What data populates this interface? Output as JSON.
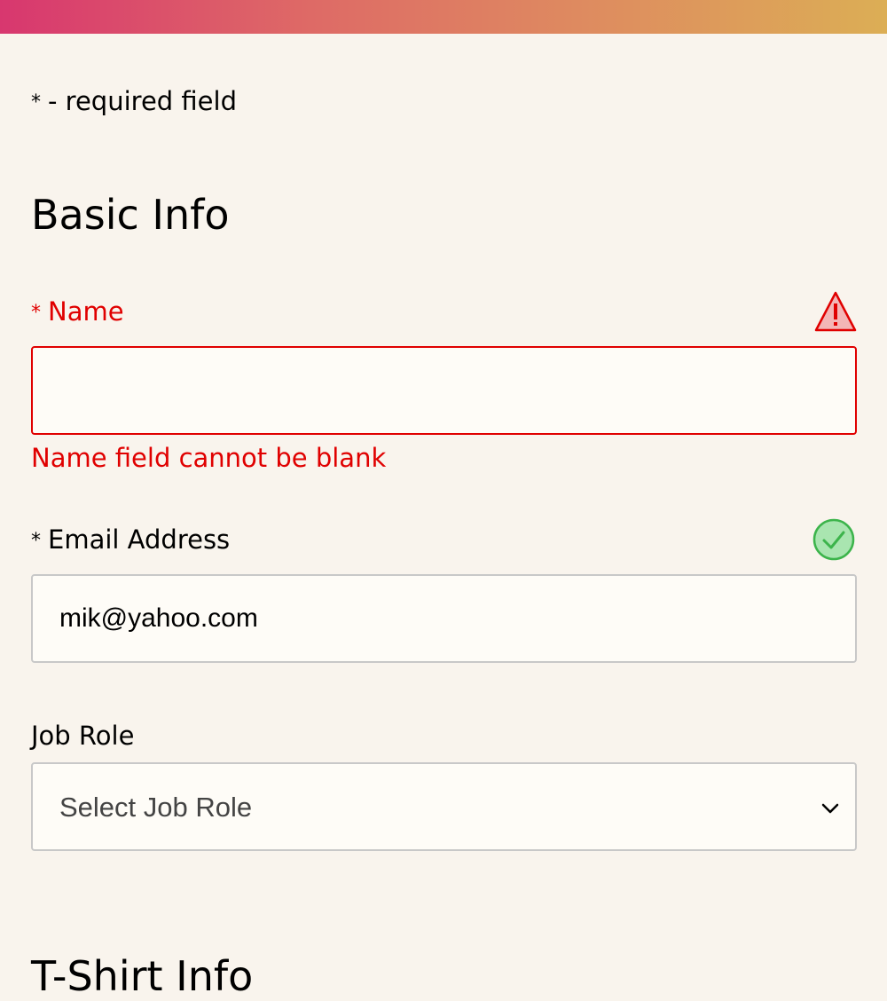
{
  "required_note": {
    "symbol": "*",
    "text": "- required field"
  },
  "basic_info": {
    "title": "Basic Info",
    "name_field": {
      "symbol": "*",
      "label": "Name",
      "value": "",
      "status_icon": "warning-triangle-icon",
      "error_message": "Name field cannot be blank"
    },
    "email_field": {
      "symbol": "*",
      "label": "Email Address",
      "value": "mik@yahoo.com",
      "status_icon": "checkmark-circle-icon"
    },
    "job_role_field": {
      "label": "Job Role",
      "selected": "Select Job Role",
      "icon": "chevron-down-icon"
    }
  },
  "tshirt_info": {
    "title": "T-Shirt Info"
  },
  "colors": {
    "error": "#e00000",
    "success": "#3cb44b",
    "background": "#f9f4ed",
    "input_background": "#fefcf7"
  }
}
